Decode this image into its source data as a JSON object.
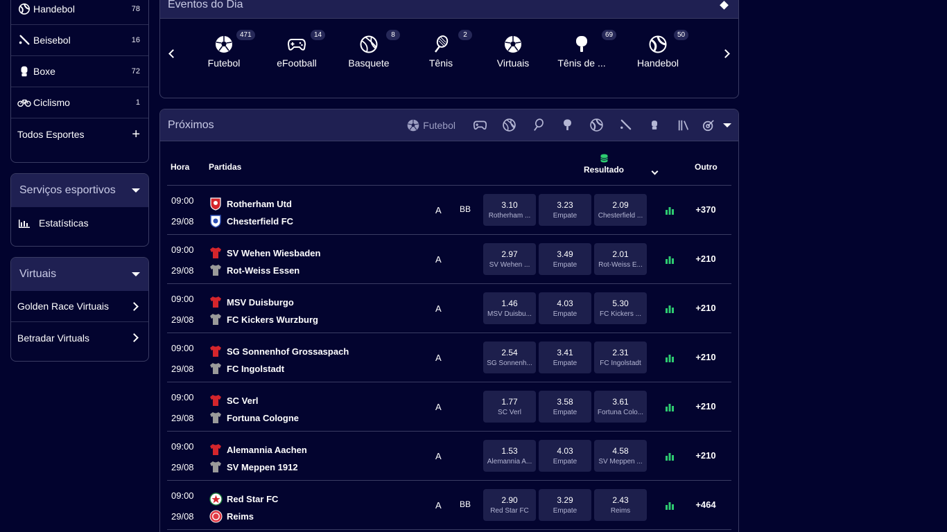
{
  "sidebar": {
    "sports": [
      {
        "label": "Handebol",
        "count": "78",
        "icon": "handball-icon"
      },
      {
        "label": "Beisebol",
        "count": "16",
        "icon": "baseball-bat-icon"
      },
      {
        "label": "Boxe",
        "count": "72",
        "icon": "boxing-glove-icon"
      },
      {
        "label": "Ciclismo",
        "count": "1",
        "icon": "bicycle-icon"
      }
    ],
    "all_sports": "Todos Esportes",
    "services": {
      "title": "Serviços esportivos",
      "items": [
        {
          "label": "Estatísticas",
          "icon": "bar-chart-icon"
        }
      ]
    },
    "virtuals": {
      "title": "Virtuais",
      "items": [
        {
          "label": "Golden Race Virtuais"
        },
        {
          "label": "Betradar Virtuals"
        }
      ]
    }
  },
  "events": {
    "title": "Eventos do Dia",
    "items": [
      {
        "label": "Futebol",
        "count": "471",
        "icon": "soccer-ball-icon"
      },
      {
        "label": "eFootball",
        "count": "14",
        "icon": "gamepad-icon"
      },
      {
        "label": "Basquete",
        "count": "8",
        "icon": "basketball-icon"
      },
      {
        "label": "Tênis",
        "count": "2",
        "icon": "tennis-racket-icon"
      },
      {
        "label": "Virtuais",
        "count": "",
        "icon": "soccer-ball-icon"
      },
      {
        "label": "Tênis de ...",
        "count": "69",
        "icon": "table-tennis-icon"
      },
      {
        "label": "Handebol",
        "count": "50",
        "icon": "handball-icon"
      }
    ]
  },
  "upcoming": {
    "title": "Próximos",
    "filter_active": "Futebol",
    "filter_icons": [
      "gamepad-icon",
      "basketball-icon",
      "tennis-racket-icon",
      "table-tennis-icon",
      "handball-icon",
      "baseball-bat-icon",
      "boxing-glove-icon",
      "library-icon",
      "target-icon"
    ],
    "headers": {
      "time": "Hora",
      "match": "Partidas",
      "result": "Resultado",
      "other": "Outro"
    },
    "matches": [
      {
        "time": "09:00",
        "date": "29/08",
        "home": "Rotherham Utd",
        "away": "Chesterfield FC",
        "tag": "A",
        "bb": "BB",
        "odds": [
          {
            "v": "3.10",
            "n": "Rotherham ..."
          },
          {
            "v": "3.23",
            "n": "Empate"
          },
          {
            "v": "2.09",
            "n": "Chesterfield ..."
          }
        ],
        "more": "+370",
        "crest": "crest"
      },
      {
        "time": "09:00",
        "date": "29/08",
        "home": "SV Wehen Wiesbaden",
        "away": "Rot-Weiss Essen",
        "tag": "A",
        "bb": "",
        "odds": [
          {
            "v": "2.97",
            "n": "SV Wehen ..."
          },
          {
            "v": "3.49",
            "n": "Empate"
          },
          {
            "v": "2.01",
            "n": "Rot-Weiss E..."
          }
        ],
        "more": "+210",
        "crest": "shirt"
      },
      {
        "time": "09:00",
        "date": "29/08",
        "home": "MSV Duisburgo",
        "away": "FC Kickers Wurzburg",
        "tag": "A",
        "bb": "",
        "odds": [
          {
            "v": "1.46",
            "n": "MSV Duisbu..."
          },
          {
            "v": "4.03",
            "n": "Empate"
          },
          {
            "v": "5.30",
            "n": "FC Kickers ..."
          }
        ],
        "more": "+210",
        "crest": "shirt"
      },
      {
        "time": "09:00",
        "date": "29/08",
        "home": "SG Sonnenhof Grossaspach",
        "away": "FC Ingolstadt",
        "tag": "A",
        "bb": "",
        "odds": [
          {
            "v": "2.54",
            "n": "SG Sonnenh..."
          },
          {
            "v": "3.41",
            "n": "Empate"
          },
          {
            "v": "2.31",
            "n": "FC Ingolstadt"
          }
        ],
        "more": "+210",
        "crest": "shirt"
      },
      {
        "time": "09:00",
        "date": "29/08",
        "home": "SC Verl",
        "away": "Fortuna Cologne",
        "tag": "A",
        "bb": "",
        "odds": [
          {
            "v": "1.77",
            "n": "SC Verl"
          },
          {
            "v": "3.58",
            "n": "Empate"
          },
          {
            "v": "3.61",
            "n": "Fortuna Colo..."
          }
        ],
        "more": "+210",
        "crest": "shirt"
      },
      {
        "time": "09:00",
        "date": "29/08",
        "home": "Alemannia Aachen",
        "away": "SV Meppen 1912",
        "tag": "A",
        "bb": "",
        "odds": [
          {
            "v": "1.53",
            "n": "Alemannia A..."
          },
          {
            "v": "4.03",
            "n": "Empate"
          },
          {
            "v": "4.58",
            "n": "SV Meppen ..."
          }
        ],
        "more": "+210",
        "crest": "shirt"
      },
      {
        "time": "09:00",
        "date": "29/08",
        "home": "Red Star FC",
        "away": "Reims",
        "tag": "A",
        "bb": "BB",
        "odds": [
          {
            "v": "2.90",
            "n": "Red Star FC"
          },
          {
            "v": "3.29",
            "n": "Empate"
          },
          {
            "v": "2.43",
            "n": "Reims"
          }
        ],
        "more": "+464",
        "crest": "crest2"
      }
    ]
  },
  "colors": {
    "background": "#02032e",
    "panel_header": "#1f2052",
    "odd_box": "#1d1f4c",
    "accent_green": "#2ecc71",
    "shirt_home": "#d4252c",
    "shirt_away": "#9a9a9a"
  }
}
